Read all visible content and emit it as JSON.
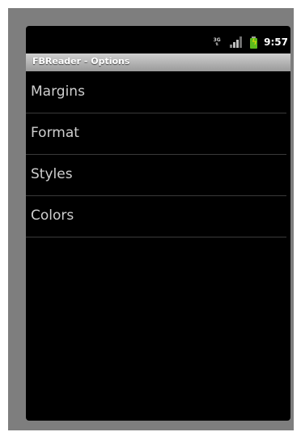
{
  "status_bar": {
    "network_label": "3G",
    "time": "9:57"
  },
  "title_bar": {
    "title": "FBReader - Options"
  },
  "options": [
    {
      "label": "Margins"
    },
    {
      "label": "Format"
    },
    {
      "label": "Styles"
    },
    {
      "label": "Colors"
    }
  ],
  "colors": {
    "frame": "#7e7e7e",
    "screen": "#000000",
    "title_bar": "#b5b5b5",
    "battery": "#5dbb1d",
    "option_text": "#cfcfcf"
  },
  "icons": [
    "network-3g-icon",
    "signal-strength-icon",
    "battery-charging-icon"
  ]
}
